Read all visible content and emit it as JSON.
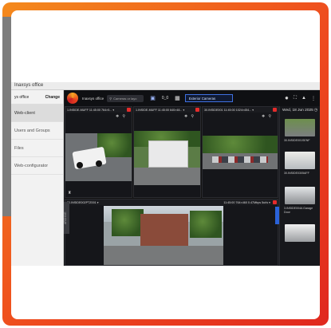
{
  "browser": {
    "title": "Inaxsys office"
  },
  "sidebar": {
    "site_name": "ys office",
    "change_label": "Change",
    "items": [
      {
        "label": "Web-client",
        "active": true
      },
      {
        "label": "Users and Groups",
        "active": false
      },
      {
        "label": "Files",
        "active": false
      },
      {
        "label": "Web-configurator",
        "active": false
      }
    ]
  },
  "topbar": {
    "site": "Inaxsys office",
    "search_placeholder": "Cameras or layo",
    "layout_name": "Exterior Cameras",
    "layout_counter": "0_0",
    "colors": {
      "accent": "#3f70e0",
      "record": "#e52b2b"
    }
  },
  "cameras": [
    {
      "head": "1.INSIDE-MUFF  11:45:00  764×5... ▾"
    },
    {
      "head": "1.INSIDE-MUFF 11:45:00  640×48... ▾"
    },
    {
      "head": "30.INSIDE001  11:45:00  1024×454... ▾"
    },
    {
      "head": "30.INSIDE002PTZ001 ▾",
      "right": "11:45:00   764×460 0.47Mbps 5ut/s ▾"
    }
  ],
  "side_label": "ARCHIVE",
  "right_panel": {
    "date": "Wed, 18 Jun 2025",
    "thumbs": [
      {
        "label": "30.INSIDE001SENF"
      },
      {
        "label": "30.INSIDE0305AFF"
      },
      {
        "label": "3.INSIDE004A Garage Door"
      },
      {
        "label": ""
      }
    ]
  },
  "icons": [
    "video-wall-icon",
    "display-icon",
    "network-icon",
    "layout-icon",
    "fullscreen-icon",
    "lock-icon",
    "more-icon",
    "clock-icon",
    "user-icon"
  ]
}
